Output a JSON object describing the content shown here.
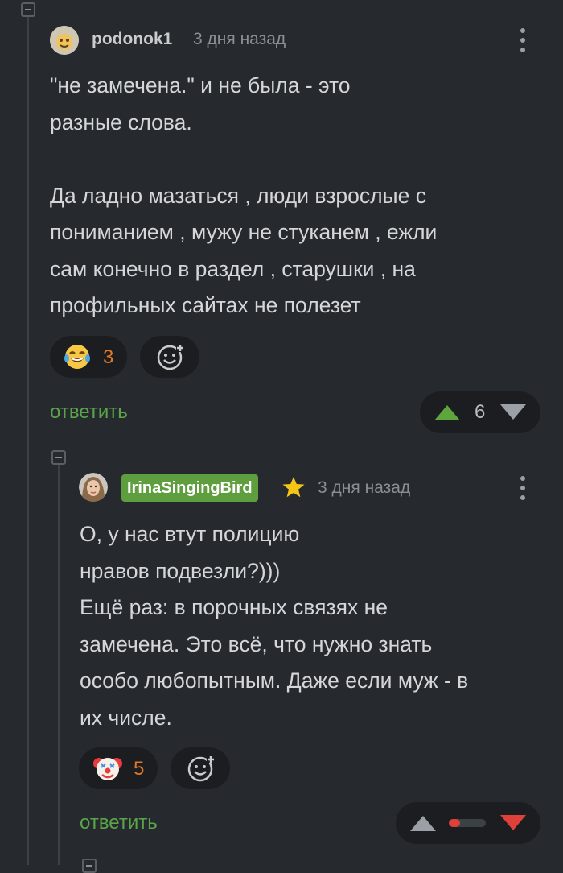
{
  "comments": [
    {
      "username": "podonok1",
      "time": "3 дня назад",
      "text": "\"не замечена.\" и не была - это\nразные слова.\n\nДа ладно мазаться , люди взрослые с\nпониманием , мужу не стуканем , ежли\nсам конечно в раздел , старушки , на\nпрофильных сайтах не полезет",
      "reaction": {
        "icon": "laughing-tears-emoji",
        "count": "3"
      },
      "add_reaction_icon": "add-emoji-icon",
      "reply_label": "ответить",
      "votes": {
        "count": "6",
        "up_color": "#5fa53d",
        "down_color": "#9aa0a5"
      }
    },
    {
      "username": "IrinaSingingBird",
      "badge_color": "#5f9e3f",
      "star_icon": "star-icon",
      "time": "3 дня назад",
      "text": "О, у нас втут полицию\nнравов подвезли?)))\nЕщё раз: в порочных связях не\nзамечена. Это всё, что нужно знать\nособо любопытным. Даже если муж - в\nих числе.",
      "reaction": {
        "icon": "clown-emoji",
        "count": "5"
      },
      "add_reaction_icon": "add-emoji-icon",
      "reply_label": "ответить",
      "votes": {
        "up_color": "#9aa0a5",
        "down_color": "#e0403a",
        "bar_color": "#e0403a",
        "rating_bar_fill": 0.3
      }
    }
  ]
}
